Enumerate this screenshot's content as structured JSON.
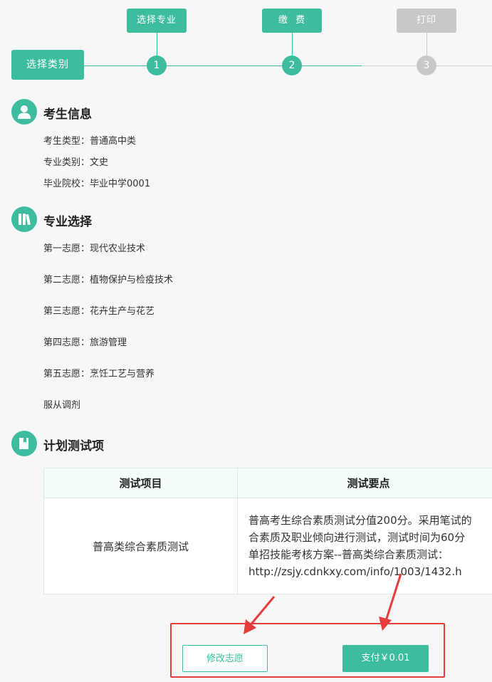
{
  "steps": {
    "category_label": "选择类别",
    "items": [
      {
        "label": "选择专业",
        "number": "1",
        "state": "done"
      },
      {
        "label": "缴  费",
        "number": "2",
        "state": "done"
      },
      {
        "label": "打印",
        "number": "3",
        "state": "pending"
      }
    ]
  },
  "student_info": {
    "title": "考生信息",
    "rows": [
      "考生类型：普通高中类",
      "专业类别：文史",
      "毕业院校：毕业中学0001"
    ]
  },
  "major_choice": {
    "title": "专业选择",
    "rows": [
      "第一志愿：现代农业技术",
      "第二志愿：植物保护与检疫技术",
      "第三志愿：花卉生产与花艺",
      "第四志愿：旅游管理",
      "第五志愿：烹饪工艺与营养",
      "服从调剂"
    ]
  },
  "test_plan": {
    "title": "计划测试项",
    "headers": [
      "测试项目",
      "测试要点"
    ],
    "row": {
      "item": "普高类综合素质测试",
      "points": [
        "普高考生综合素质测试分值200分。采用笔试的",
        "合素质及职业倾向进行测试，测试时间为60分",
        "单招技能考核方案--普高类综合素质测试：",
        "http://zsjy.cdnkxy.com/info/1003/1432.h"
      ]
    }
  },
  "actions": {
    "modify_label": "修改志愿",
    "pay_label": "支付￥0.01"
  },
  "colors": {
    "accent": "#3dbd9d",
    "inactive": "#c8c8c8",
    "highlight": "#e63c3c"
  }
}
